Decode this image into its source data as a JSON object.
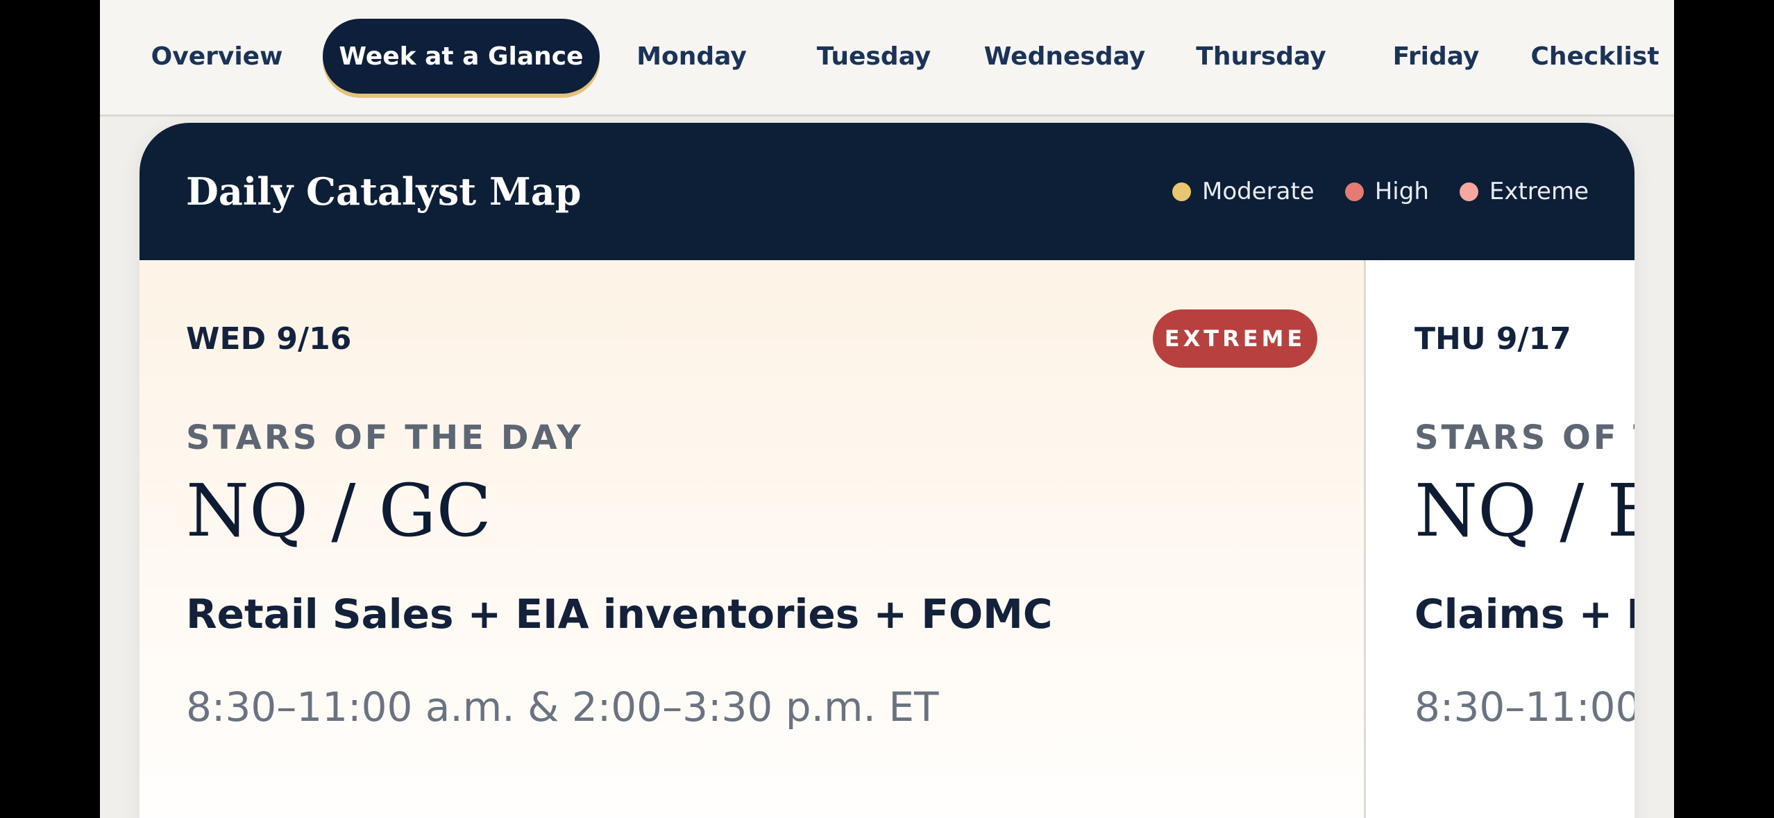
{
  "nav": {
    "tabs": [
      {
        "label": "Overview",
        "active": false
      },
      {
        "label": "Week at a Glance",
        "active": true
      },
      {
        "label": "Monday",
        "active": false
      },
      {
        "label": "Tuesday",
        "active": false
      },
      {
        "label": "Wednesday",
        "active": false
      },
      {
        "label": "Thursday",
        "active": false
      },
      {
        "label": "Friday",
        "active": false
      },
      {
        "label": "Checklist",
        "active": false
      }
    ]
  },
  "card": {
    "title": "Daily Catalyst Map",
    "legend": [
      {
        "label": "Moderate",
        "color": "#e8c76e"
      },
      {
        "label": "High",
        "color": "#e47c74"
      },
      {
        "label": "Extreme",
        "color": "#f6a7a0"
      }
    ]
  },
  "days": [
    {
      "date": "WED 9/16",
      "badge": "EXTREME",
      "stars_label": "STARS OF THE DAY",
      "instruments": "NQ / GC",
      "catalysts": "Retail Sales + EIA inventories + FOMC",
      "time_window": "8:30–11:00 a.m. & 2:00–3:30 p.m. ET"
    },
    {
      "date": "THU 9/17",
      "stars_label": "STARS OF T",
      "instruments": "NQ / E",
      "catalysts": "Claims + Pl",
      "time_window": "8:30–11:00"
    }
  ],
  "colors": {
    "navy": "#0d1f36",
    "accent_gold": "#e3c27b",
    "extreme_badge": "#b8403e"
  }
}
